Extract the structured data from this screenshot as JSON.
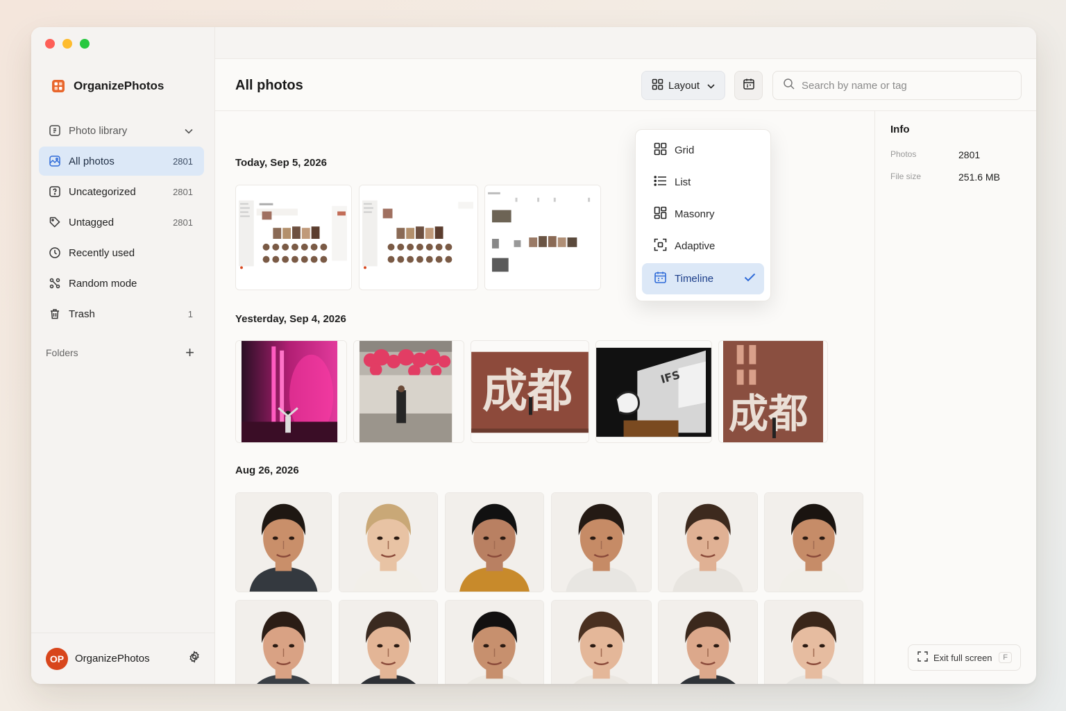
{
  "app": {
    "name": "OrganizePhotos"
  },
  "sidebar": {
    "items": [
      {
        "label": "Photo library",
        "count": "",
        "icon": "library-icon"
      },
      {
        "label": "All photos",
        "count": "2801",
        "icon": "photos-icon"
      },
      {
        "label": "Uncategorized",
        "count": "2801",
        "icon": "uncategorized-icon"
      },
      {
        "label": "Untagged",
        "count": "2801",
        "icon": "tag-icon"
      },
      {
        "label": "Recently used",
        "count": "",
        "icon": "clock-icon"
      },
      {
        "label": "Random mode",
        "count": "",
        "icon": "shuffle-icon"
      },
      {
        "label": "Trash",
        "count": "1",
        "icon": "trash-icon"
      }
    ],
    "folders_label": "Folders",
    "footer": {
      "avatar_initials": "OP",
      "name": "OrganizePhotos"
    }
  },
  "header": {
    "title": "All photos",
    "layout_label": "Layout",
    "search_placeholder": "Search by name or tag"
  },
  "layout_menu": {
    "items": [
      {
        "label": "Grid",
        "icon": "grid-icon",
        "selected": false
      },
      {
        "label": "List",
        "icon": "list-icon",
        "selected": false
      },
      {
        "label": "Masonry",
        "icon": "masonry-icon",
        "selected": false
      },
      {
        "label": "Adaptive",
        "icon": "adaptive-icon",
        "selected": false
      },
      {
        "label": "Timeline",
        "icon": "calendar-icon",
        "selected": true
      }
    ]
  },
  "sections": [
    {
      "title": "Today, Sep 5, 2026",
      "thumbs": [
        "app-screenshot-grid",
        "app-screenshot-grid",
        "app-screenshot-timeline"
      ]
    },
    {
      "title": "Yesterday, Sep 4, 2026",
      "thumbs": [
        "night-fountain-pink-lights",
        "pink-flowers-street-portrait",
        "chengdu-wall-sign",
        "ifs-building-panda",
        "chengdu-wall-sign-close"
      ]
    },
    {
      "title": "Aug 26, 2026",
      "thumbs": [
        "portrait-man-curly-hair",
        "portrait-blonde-child",
        "portrait-woman-black-bob",
        "portrait-woman-curly-hair",
        "portrait-woman-wavy-hair",
        "portrait-woman-smiling",
        "portrait-man-short-hair",
        "portrait-man-beard",
        "portrait-man-smiling",
        "portrait-woman-long-hair",
        "portrait-woman-ponytail",
        "portrait-woman-bob"
      ]
    }
  ],
  "info": {
    "title": "Info",
    "rows": [
      {
        "key": "Photos",
        "value": "2801"
      },
      {
        "key": "File size",
        "value": "251.6 MB"
      }
    ],
    "exit_label": "Exit full screen",
    "exit_key": "F"
  },
  "colors": {
    "accent": "#2f6bd8",
    "active_bg": "#dce8f7",
    "brand": "#e8662c",
    "avatar": "#d8461c"
  }
}
